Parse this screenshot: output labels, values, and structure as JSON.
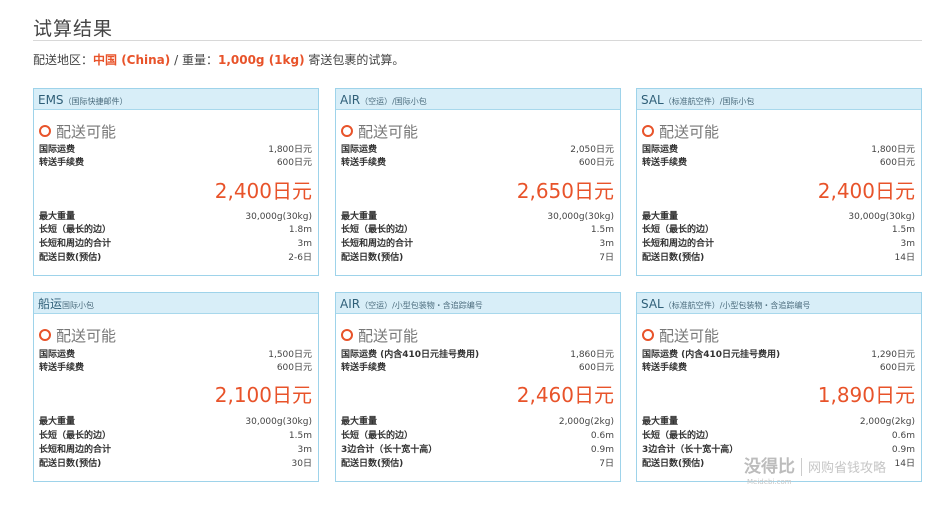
{
  "page": {
    "title": "试算结果",
    "info": {
      "region_label": "配送地区：",
      "region": "中国 (China)",
      "weight_label": " / 重量：",
      "weight": "1,000g (1kg)",
      "suffix": " 寄送包裹的试算。"
    }
  },
  "cards": [
    {
      "name_main": "EMS",
      "name_sub": "（国际快捷邮件）",
      "availability": "配送可能",
      "fees": [
        {
          "label": "国际运费",
          "value": "1,800日元"
        },
        {
          "label": "转送手续费",
          "value": "600日元"
        }
      ],
      "total": "2,400日元",
      "specs": [
        {
          "label": "最大重量",
          "value": "30,000g(30kg)"
        },
        {
          "label": "长短（最长的边）",
          "value": "1.8m"
        },
        {
          "label": "长短和周边的合计",
          "value": "3m"
        },
        {
          "label": "配送日数(预估)",
          "value": "2-6日"
        }
      ]
    },
    {
      "name_main": "AIR",
      "name_sub": "（空运）/国际小包",
      "availability": "配送可能",
      "fees": [
        {
          "label": "国际运费",
          "value": "2,050日元"
        },
        {
          "label": "转送手续费",
          "value": "600日元"
        }
      ],
      "total": "2,650日元",
      "specs": [
        {
          "label": "最大重量",
          "value": "30,000g(30kg)"
        },
        {
          "label": "长短（最长的边）",
          "value": "1.5m"
        },
        {
          "label": "长短和周边的合计",
          "value": "3m"
        },
        {
          "label": "配送日数(预估)",
          "value": "7日"
        }
      ]
    },
    {
      "name_main": "SAL",
      "name_sub": "（标准航空件）/国际小包",
      "availability": "配送可能",
      "fees": [
        {
          "label": "国际运费",
          "value": "1,800日元"
        },
        {
          "label": "转送手续费",
          "value": "600日元"
        }
      ],
      "total": "2,400日元",
      "specs": [
        {
          "label": "最大重量",
          "value": "30,000g(30kg)"
        },
        {
          "label": "长短（最长的边）",
          "value": "1.5m"
        },
        {
          "label": "长短和周边的合计",
          "value": "3m"
        },
        {
          "label": "配送日数(预估)",
          "value": "14日"
        }
      ]
    },
    {
      "name_main": "船运",
      "name_sub": "国际小包",
      "availability": "配送可能",
      "fees": [
        {
          "label": "国际运费",
          "value": "1,500日元"
        },
        {
          "label": "转送手续费",
          "value": "600日元"
        }
      ],
      "total": "2,100日元",
      "specs": [
        {
          "label": "最大重量",
          "value": "30,000g(30kg)"
        },
        {
          "label": "长短（最长的边）",
          "value": "1.5m"
        },
        {
          "label": "长短和周边的合计",
          "value": "3m"
        },
        {
          "label": "配送日数(预估)",
          "value": "30日"
        }
      ]
    },
    {
      "name_main": "AIR",
      "name_sub": "（空运）/小型包装物・含追踪编号",
      "availability": "配送可能",
      "fees": [
        {
          "label": "国际运费 (内含410日元挂号费用)",
          "value": "1,860日元"
        },
        {
          "label": "转送手续费",
          "value": "600日元"
        }
      ],
      "total": "2,460日元",
      "specs": [
        {
          "label": "最大重量",
          "value": "2,000g(2kg)"
        },
        {
          "label": "长短（最长的边）",
          "value": "0.6m"
        },
        {
          "label": "3边合计（长十宽十高）",
          "value": "0.9m"
        },
        {
          "label": "配送日数(预估)",
          "value": "7日"
        }
      ]
    },
    {
      "name_main": "SAL",
      "name_sub": "（标准航空件）/小型包装物・含追踪编号",
      "availability": "配送可能",
      "fees": [
        {
          "label": "国际运费 (内含410日元挂号费用)",
          "value": "1,290日元"
        },
        {
          "label": "转送手续费",
          "value": "600日元"
        }
      ],
      "total": "1,890日元",
      "specs": [
        {
          "label": "最大重量",
          "value": "2,000g(2kg)"
        },
        {
          "label": "长短（最长的边）",
          "value": "0.6m"
        },
        {
          "label": "3边合计（长十宽十高）",
          "value": "0.9m"
        },
        {
          "label": "配送日数(预估)",
          "value": "14日"
        }
      ]
    }
  ],
  "watermark": {
    "brand": "没得比",
    "slogan": "网购省钱攻略",
    "url": "Meidebi.com"
  },
  "colors": {
    "accent": "#e8532a",
    "card_border": "#9ed3ea",
    "card_header": "#d8eef8"
  }
}
